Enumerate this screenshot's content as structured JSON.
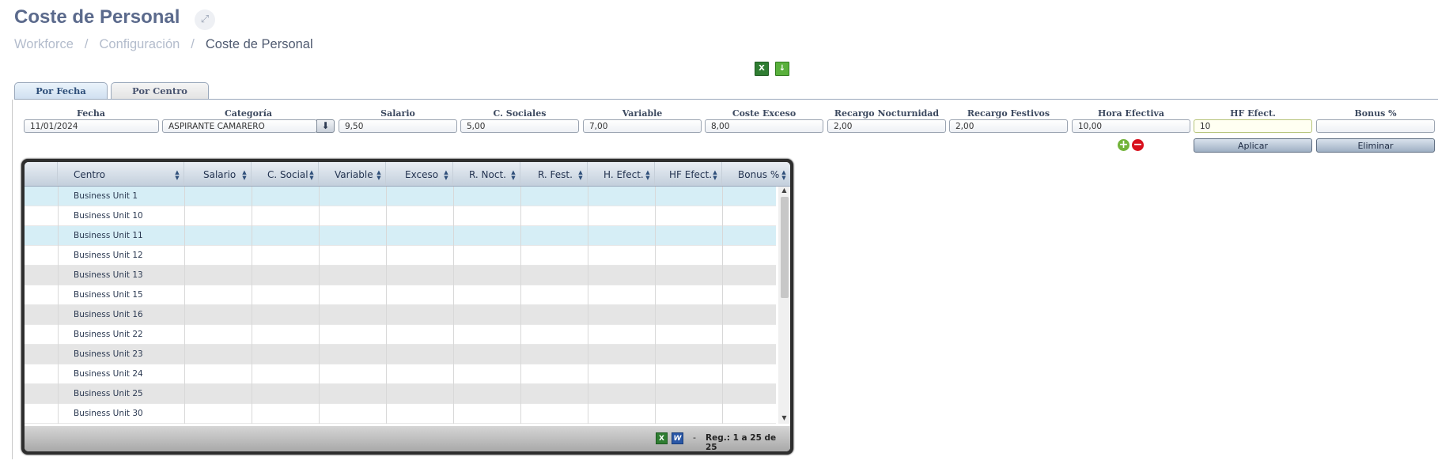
{
  "header": {
    "title": "Coste de Personal",
    "breadcrumb": [
      "Workforce",
      "Configuración",
      "Coste de Personal"
    ],
    "separator": "/"
  },
  "toolbar": {
    "excel_icon": "excel-icon",
    "download_icon": "download-icon"
  },
  "tabs": [
    {
      "label": "Por Fecha",
      "active": true
    },
    {
      "label": "Por Centro",
      "active": false
    }
  ],
  "form": {
    "fields": [
      {
        "label": "Fecha",
        "value": "11/01/2024"
      },
      {
        "label": "Categoría",
        "value": "ASPIRANTE CAMARERO"
      },
      {
        "label": "Salario",
        "value": "9,50"
      },
      {
        "label": "C. Sociales",
        "value": "5,00"
      },
      {
        "label": "Variable",
        "value": "7,00"
      },
      {
        "label": "Coste Exceso",
        "value": "8,00"
      },
      {
        "label": "Recargo Nocturnidad",
        "value": "2,00"
      },
      {
        "label": "Recargo Festivos",
        "value": "2,00"
      },
      {
        "label": "Hora Efectiva",
        "value": "10,00"
      },
      {
        "label": "HF Efect.",
        "value": "10"
      },
      {
        "label": "Bonus %",
        "value": ""
      }
    ],
    "buttons": {
      "apply": "Aplicar",
      "delete": "Eliminar"
    }
  },
  "grid": {
    "columns": [
      "Centro",
      "Salario",
      "C. Social",
      "Variable",
      "Exceso",
      "R. Noct.",
      "R. Fest.",
      "H. Efect.",
      "HF Efect.",
      "Bonus %"
    ],
    "rows": [
      {
        "centro": "Business Unit 1",
        "style": "sel"
      },
      {
        "centro": "Business Unit 10",
        "style": ""
      },
      {
        "centro": "Business Unit 11",
        "style": "sel"
      },
      {
        "centro": "Business Unit 12",
        "style": ""
      },
      {
        "centro": "Business Unit 13",
        "style": "alt"
      },
      {
        "centro": "Business Unit 15",
        "style": ""
      },
      {
        "centro": "Business Unit 16",
        "style": "alt"
      },
      {
        "centro": "Business Unit 22",
        "style": ""
      },
      {
        "centro": "Business Unit 23",
        "style": "alt"
      },
      {
        "centro": "Business Unit 24",
        "style": ""
      },
      {
        "centro": "Business Unit 25",
        "style": "alt"
      },
      {
        "centro": "Business Unit 30",
        "style": ""
      }
    ],
    "footer": {
      "dash": "-",
      "records": "Reg.: 1 a 25 de 25"
    }
  }
}
